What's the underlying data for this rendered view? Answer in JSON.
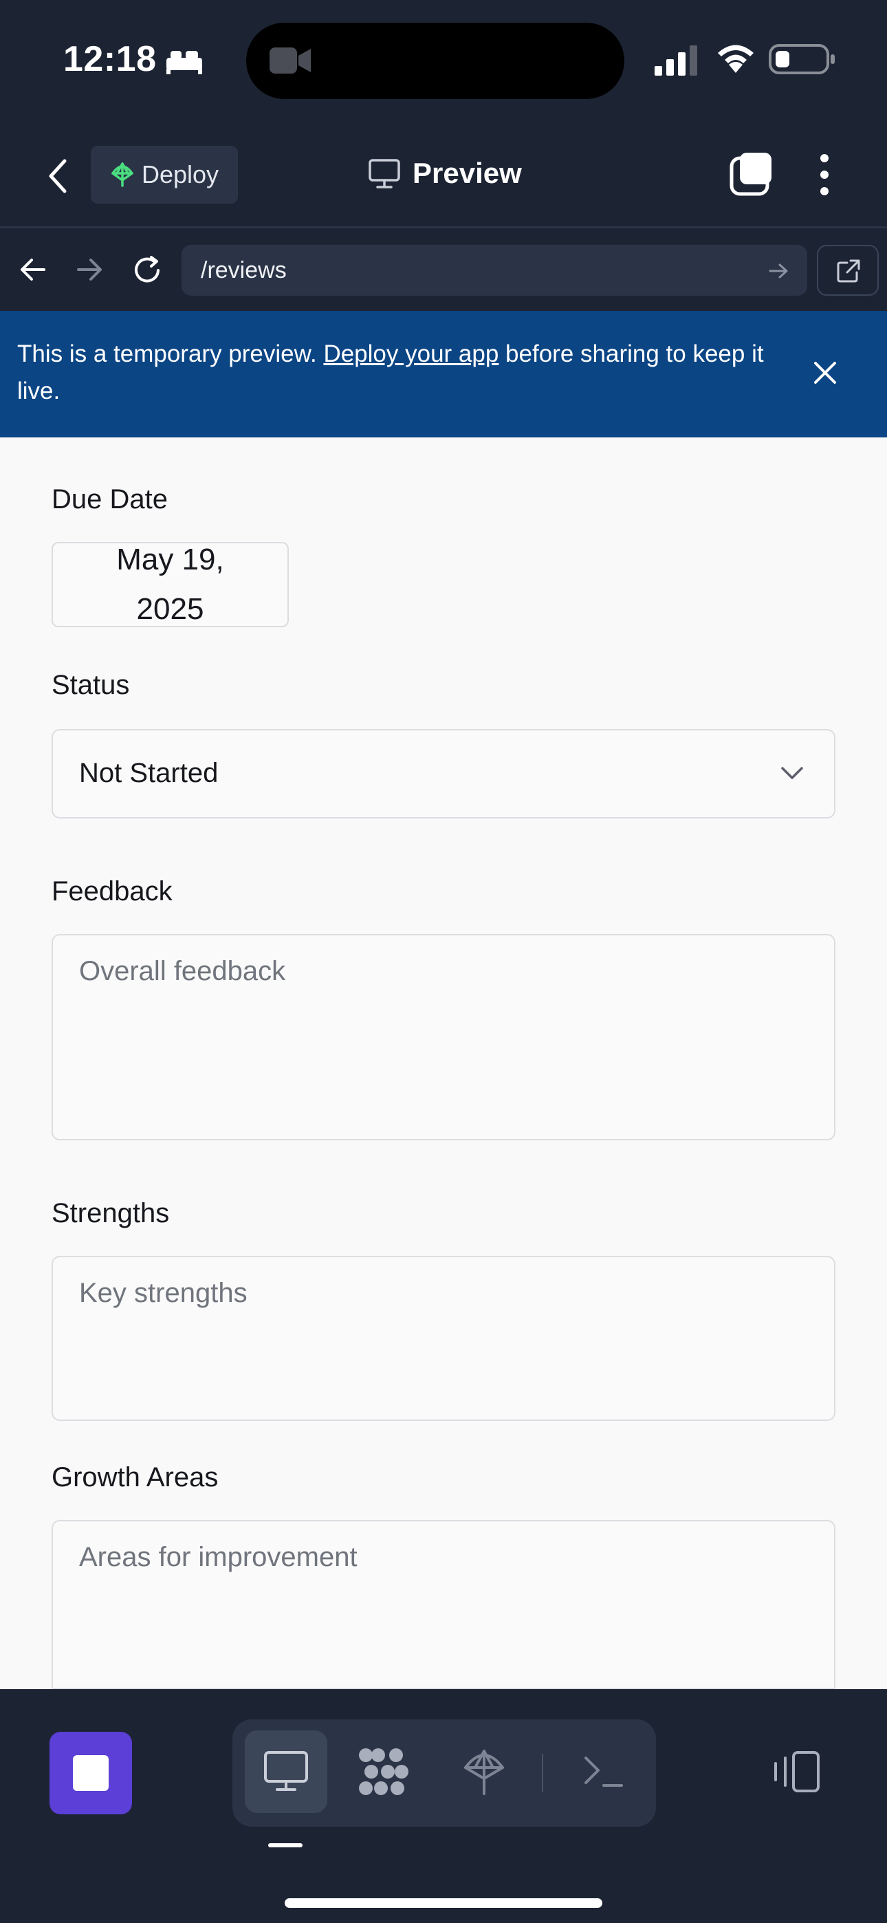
{
  "status_bar": {
    "time": "12:18"
  },
  "header": {
    "deploy_label": "Deploy",
    "title": "Preview"
  },
  "url_bar": {
    "path": "/reviews"
  },
  "banner": {
    "text_before": "This is a temporary preview. ",
    "link_text": "Deploy your app",
    "text_after": " before sharing to keep it live."
  },
  "form": {
    "due_date_label": "Due Date",
    "due_date_value": "May 19, 2025",
    "status_label": "Status",
    "status_value": "Not Started",
    "feedback_label": "Feedback",
    "feedback_placeholder": "Overall feedback",
    "strengths_label": "Strengths",
    "strengths_placeholder": "Key strengths",
    "growth_label": "Growth Areas",
    "growth_placeholder": "Areas for improvement"
  },
  "icons": {
    "deploy": "deploy-icon",
    "preview": "monitor-icon",
    "tabs": "tabs-icon",
    "more": "more-vertical-icon",
    "back": "arrow-left-icon",
    "forward": "arrow-right-icon",
    "reload": "reload-icon",
    "go": "arrow-right-small-icon",
    "open_external": "external-link-icon",
    "close": "close-icon",
    "chevron": "chevron-down-icon",
    "stop": "stop-icon",
    "desktop": "desktop-icon",
    "apps": "apps-icon",
    "deployments": "deploy-icon",
    "shell": "terminal-icon",
    "layout": "layout-icon"
  },
  "colors": {
    "banner": "#0b4584",
    "chrome": "#1c2333",
    "accent": "#5b3fd6"
  }
}
